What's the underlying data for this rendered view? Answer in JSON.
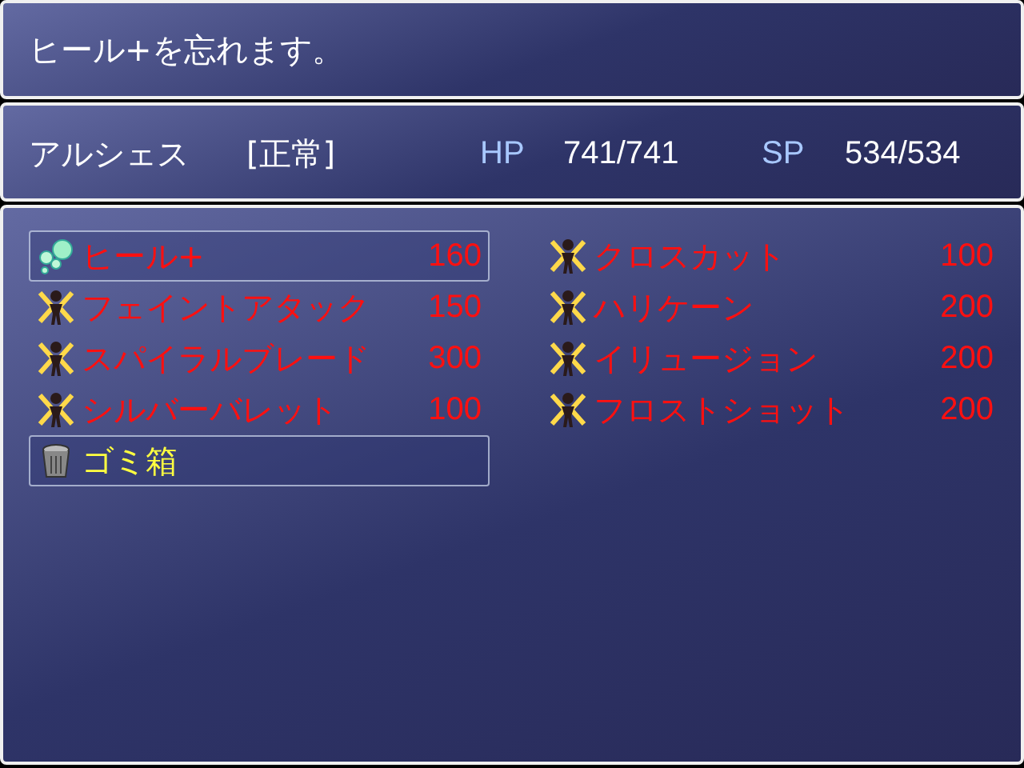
{
  "help_window": {
    "text": "ヒール+を忘れます。"
  },
  "status_window": {
    "name": "アルシェス",
    "state": "[正常]",
    "hp_label": "HP",
    "hp": "741/741",
    "sp_label": "SP",
    "sp": "534/534"
  },
  "skills": [
    {
      "kind": "heal",
      "name": "ヒール+",
      "cost": "160",
      "disabled": true,
      "selected": true
    },
    {
      "kind": "attack",
      "name": "クロスカット",
      "cost": "100",
      "disabled": true,
      "selected": false
    },
    {
      "kind": "attack",
      "name": "フェイントアタック",
      "cost": "150",
      "disabled": true,
      "selected": false
    },
    {
      "kind": "attack",
      "name": "ハリケーン",
      "cost": "200",
      "disabled": true,
      "selected": false
    },
    {
      "kind": "attack",
      "name": "スパイラルブレード",
      "cost": "300",
      "disabled": true,
      "selected": false
    },
    {
      "kind": "attack",
      "name": "イリュージョン",
      "cost": "200",
      "disabled": true,
      "selected": false
    },
    {
      "kind": "attack",
      "name": "シルバーバレット",
      "cost": "100",
      "disabled": true,
      "selected": false
    },
    {
      "kind": "attack",
      "name": "フロストショット",
      "cost": "200",
      "disabled": true,
      "selected": false
    },
    {
      "kind": "trash",
      "name": "ゴミ箱"
    }
  ]
}
